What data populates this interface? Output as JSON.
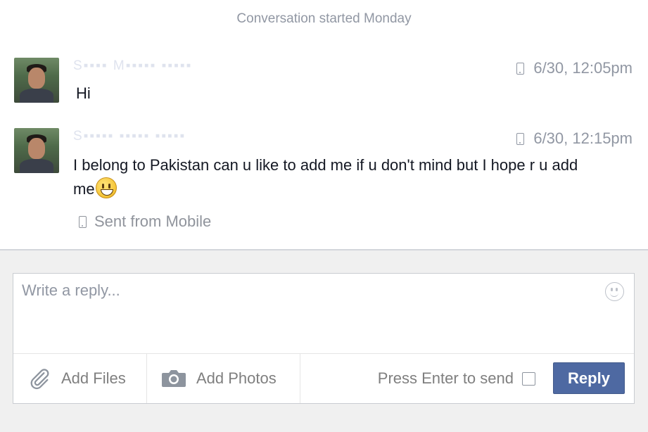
{
  "thread": {
    "conversation_started": "Conversation started Monday",
    "messages": [
      {
        "sender": "S▪▪▪▪ M▪▪▪▪▪ ▪▪▪▪▪",
        "timestamp": "6/30, 12:05pm",
        "text": "Hi"
      },
      {
        "sender": "S▪▪▪▪▪ ▪▪▪▪▪ ▪▪▪▪▪",
        "timestamp": "6/30, 12:15pm",
        "text": "I belong to Pakistan can u like to add me if u don't mind but I hope r u add me",
        "emoji": "grinning-face",
        "sent_from": "Sent from Mobile"
      }
    ]
  },
  "composer": {
    "placeholder": "Write a reply...",
    "value": "",
    "add_files": "Add Files",
    "add_photos": "Add Photos",
    "press_enter": "Press Enter to send",
    "press_enter_checked": false,
    "reply_button": "Reply"
  },
  "colors": {
    "reply_button": "#4e69a2",
    "composer_background": "#f0f0f0",
    "timestamp": "#9197a3"
  },
  "icons": {
    "message_timestamp": "phone-icon",
    "attachment": "paperclip-icon",
    "photos": "camera-icon",
    "emoji": "emoji-icon"
  }
}
